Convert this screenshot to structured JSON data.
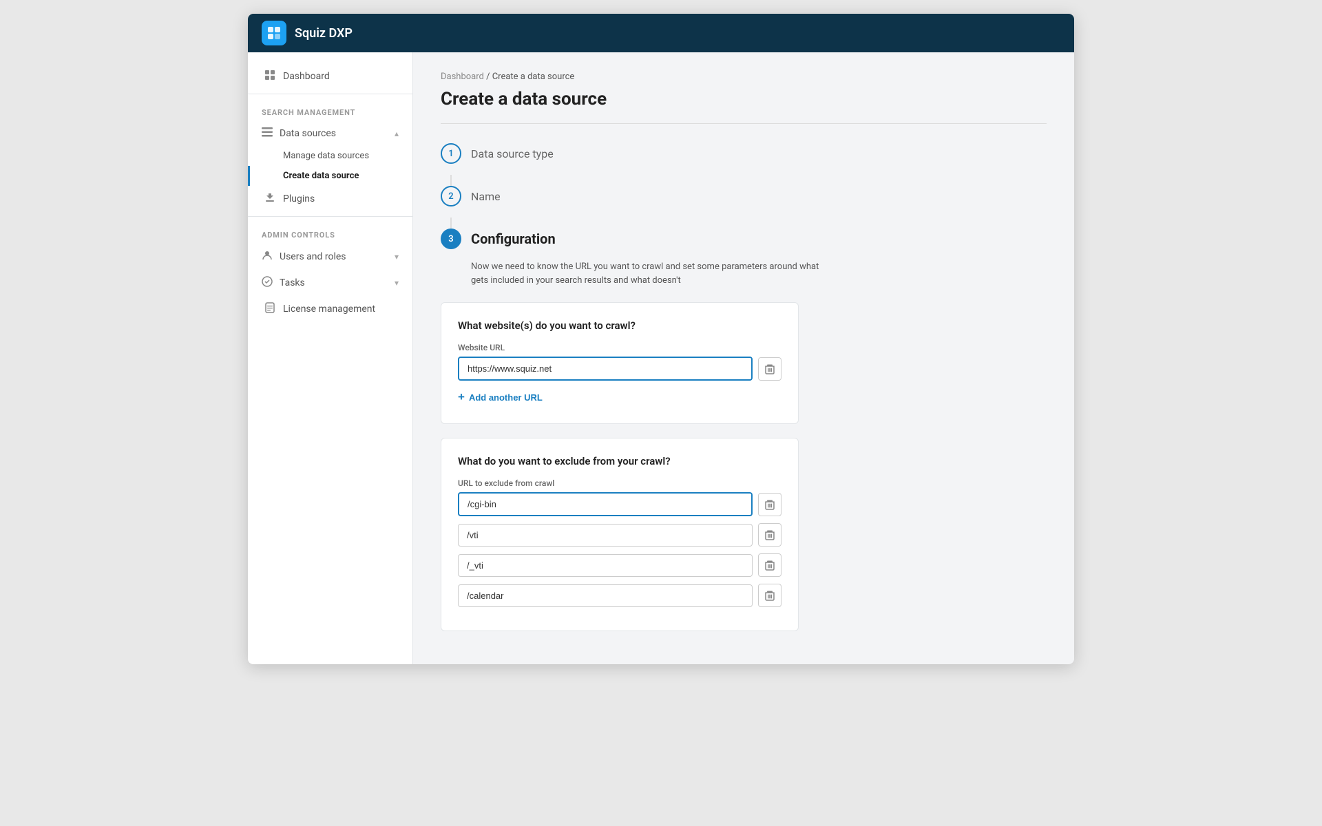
{
  "app": {
    "title": "Squiz DXP",
    "logo_symbol": "✕"
  },
  "breadcrumb": {
    "items": [
      "Dashboard",
      "Create a data source"
    ],
    "separator": "/"
  },
  "page": {
    "title": "Create a data source"
  },
  "sidebar": {
    "dashboard_label": "Dashboard",
    "sections": [
      {
        "label": "SEARCH MANAGEMENT",
        "items": [
          {
            "label": "Data sources",
            "has_arrow": true,
            "expanded": true,
            "sub_items": [
              {
                "label": "Manage data sources",
                "active": false
              },
              {
                "label": "Create data source",
                "active": true
              }
            ]
          },
          {
            "label": "Plugins",
            "has_arrow": false
          }
        ]
      },
      {
        "label": "ADMIN CONTROLS",
        "items": [
          {
            "label": "Users and roles",
            "has_arrow": true
          },
          {
            "label": "Tasks",
            "has_arrow": true
          },
          {
            "label": "License management",
            "has_arrow": false
          }
        ]
      }
    ]
  },
  "steps": [
    {
      "number": "1",
      "label": "Data source type",
      "active": false,
      "filled": false
    },
    {
      "number": "2",
      "label": "Name",
      "active": false,
      "filled": false
    },
    {
      "number": "3",
      "label": "Configuration",
      "active": true,
      "filled": true
    }
  ],
  "config": {
    "description": "Now we need to know the URL you want to crawl and set some parameters around what gets included in your search results and what doesn't",
    "website_card": {
      "title": "What website(s) do you want to crawl?",
      "url_label": "Website URL",
      "url_value": "https://www.squiz.net",
      "add_url_label": "Add another URL"
    },
    "exclude_card": {
      "title": "What do you want to exclude from your crawl?",
      "url_label": "URL to exclude from crawl",
      "urls": [
        "/cgi-bin",
        "/vti",
        "/_vti",
        "/calendar"
      ]
    }
  },
  "icons": {
    "dashboard": "▦",
    "data_sources": "≡",
    "plugins": "⚙",
    "users_roles": "👤",
    "tasks": "✔",
    "license": "📄",
    "trash": "🗑",
    "plus": "+",
    "chevron_down": "▾",
    "chevron_up": "▴"
  }
}
